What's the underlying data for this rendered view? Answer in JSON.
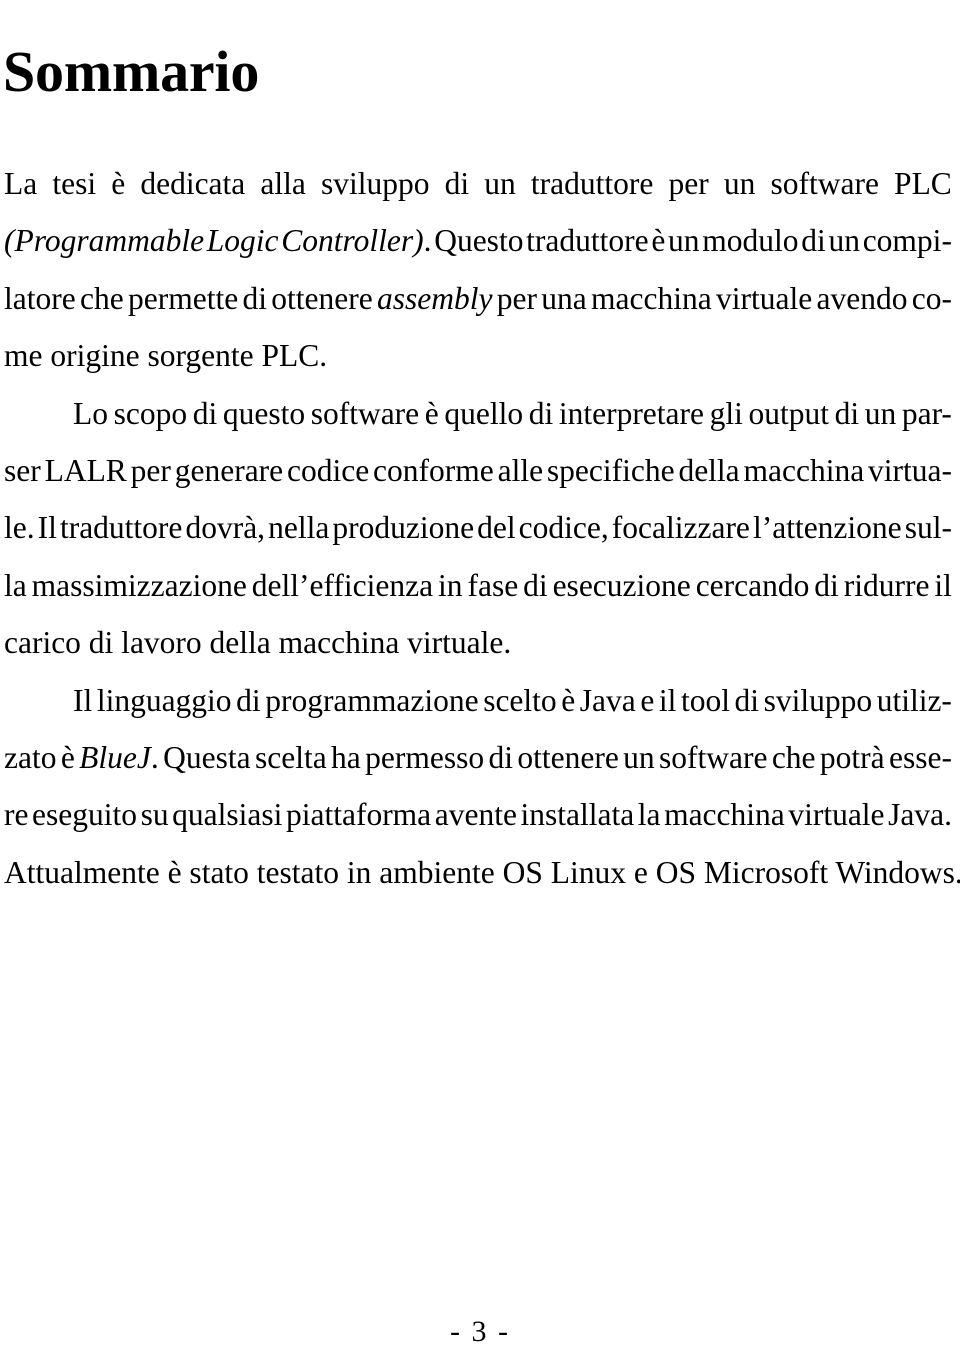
{
  "document": {
    "language": "it",
    "heading": "Sommario",
    "page_number_label": "- 3 -"
  },
  "abstract": {
    "paragraphs": [
      {
        "id": "p1",
        "indent_first_line": false,
        "text": "La tesi è dedicata alla sviluppo di un traduttore per un software PLC (Programmable Logic Controller). Questo traduttore è un modulo di un compilatore che permette di ottenere assembly per una macchina virtuale avendo come origine sorgente PLC.",
        "italic_spans": [
          "Programmable Logic Controller",
          "assembly"
        ]
      },
      {
        "id": "p2",
        "indent_first_line": true,
        "text": "Lo scopo di questo software è quello di interpretare gli output di un parser LALR per generare codice conforme alle specifiche della macchina virtuale. Il traduttore dovrà, nella produzione del codice, focalizzare l’attenzione sulla massimizzazione dell’efficienza in fase di esecuzione cercando di ridurre il carico di lavoro della macchina virtuale.",
        "italic_spans": []
      },
      {
        "id": "p3",
        "indent_first_line": true,
        "text": "Il linguaggio di programmazione scelto è Java e il tool di sviluppo utilizzato è BlueJ. Questa scelta ha permesso di ottenere un software che potrà essere eseguito su qualsiasi piattaforma avente installata la macchina virtuale Java. Attualmente è stato testato in ambiente OS Linux e OS Microsoft Windows.",
        "italic_spans": [
          "BlueJ"
        ]
      }
    ],
    "lines": [
      {
        "n": 1,
        "paragraph": "p1",
        "justified": true,
        "indent": false,
        "words": [
          "La",
          "tesi",
          "è",
          "dedicata",
          "alla",
          "sviluppo",
          "di",
          "un",
          "traduttore",
          "per",
          "un",
          "software",
          "PLC"
        ]
      },
      {
        "n": 2,
        "paragraph": "p1",
        "justified": true,
        "indent": false,
        "words": [
          "(Programmable",
          "Logic",
          "Controller).",
          "Questo",
          "traduttore",
          "è",
          "un",
          "modulo",
          "di",
          "un",
          "compi-"
        ]
      },
      {
        "n": 3,
        "paragraph": "p1",
        "justified": true,
        "indent": false,
        "words": [
          "latore",
          "che",
          "permette",
          "di",
          "ottenere",
          "assembly",
          "per",
          "una",
          "macchina",
          "virtuale",
          "avendo",
          "co-"
        ]
      },
      {
        "n": 4,
        "paragraph": "p1",
        "justified": false,
        "indent": false,
        "text": "me origine sorgente PLC."
      },
      {
        "n": 5,
        "paragraph": "p2",
        "justified": true,
        "indent": true,
        "words": [
          "Lo",
          "scopo",
          "di",
          "questo",
          "software",
          "è",
          "quello",
          "di",
          "interpretare",
          "gli",
          "output",
          "di",
          "un",
          "par-"
        ]
      },
      {
        "n": 6,
        "paragraph": "p2",
        "justified": true,
        "indent": false,
        "words": [
          "ser",
          "LALR",
          "per",
          "generare",
          "codice",
          "conforme",
          "alle",
          "specifiche",
          "della",
          "macchina",
          "virtua-"
        ]
      },
      {
        "n": 7,
        "paragraph": "p2",
        "justified": true,
        "indent": false,
        "words": [
          "le.",
          "Il",
          "traduttore",
          "dovrà,",
          "nella",
          "produzione",
          "del",
          "codice,",
          "focalizzare",
          "l’attenzione",
          "sul-"
        ]
      },
      {
        "n": 8,
        "paragraph": "p2",
        "justified": true,
        "indent": false,
        "words": [
          "la",
          "massimizzazione",
          "dell’efficienza",
          "in",
          "fase",
          "di",
          "esecuzione",
          "cercando",
          "di",
          "ridurre",
          "il"
        ]
      },
      {
        "n": 9,
        "paragraph": "p2",
        "justified": false,
        "indent": false,
        "text": "carico di lavoro della macchina virtuale."
      },
      {
        "n": 10,
        "paragraph": "p3",
        "justified": true,
        "indent": true,
        "words": [
          "Il",
          "linguaggio",
          "di",
          "programmazione",
          "scelto",
          "è",
          "Java",
          "e",
          "il",
          "tool",
          "di",
          "sviluppo",
          "utiliz-"
        ]
      },
      {
        "n": 11,
        "paragraph": "p3",
        "justified": true,
        "indent": false,
        "words": [
          "zato",
          "è",
          "BlueJ.",
          "Questa",
          "scelta",
          "ha",
          "permesso",
          "di",
          "ottenere",
          "un",
          "software",
          "che",
          "potrà",
          "esse-"
        ]
      },
      {
        "n": 12,
        "paragraph": "p3",
        "justified": true,
        "indent": false,
        "words": [
          "re",
          "eseguito",
          "su",
          "qualsiasi",
          "piattaforma",
          "avente",
          "installata",
          "la",
          "macchina",
          "virtuale",
          "Java."
        ]
      },
      {
        "n": 13,
        "paragraph": "p3",
        "justified": false,
        "indent": false,
        "text": "Attualmente è stato testato in ambiente OS Linux e OS Microsoft Windows."
      }
    ],
    "italic_words": [
      "(Programmable",
      "Logic",
      "Controller)",
      "assembly",
      "BlueJ"
    ]
  },
  "colors": {
    "page_background": "#ffffff",
    "text": "#000000"
  }
}
